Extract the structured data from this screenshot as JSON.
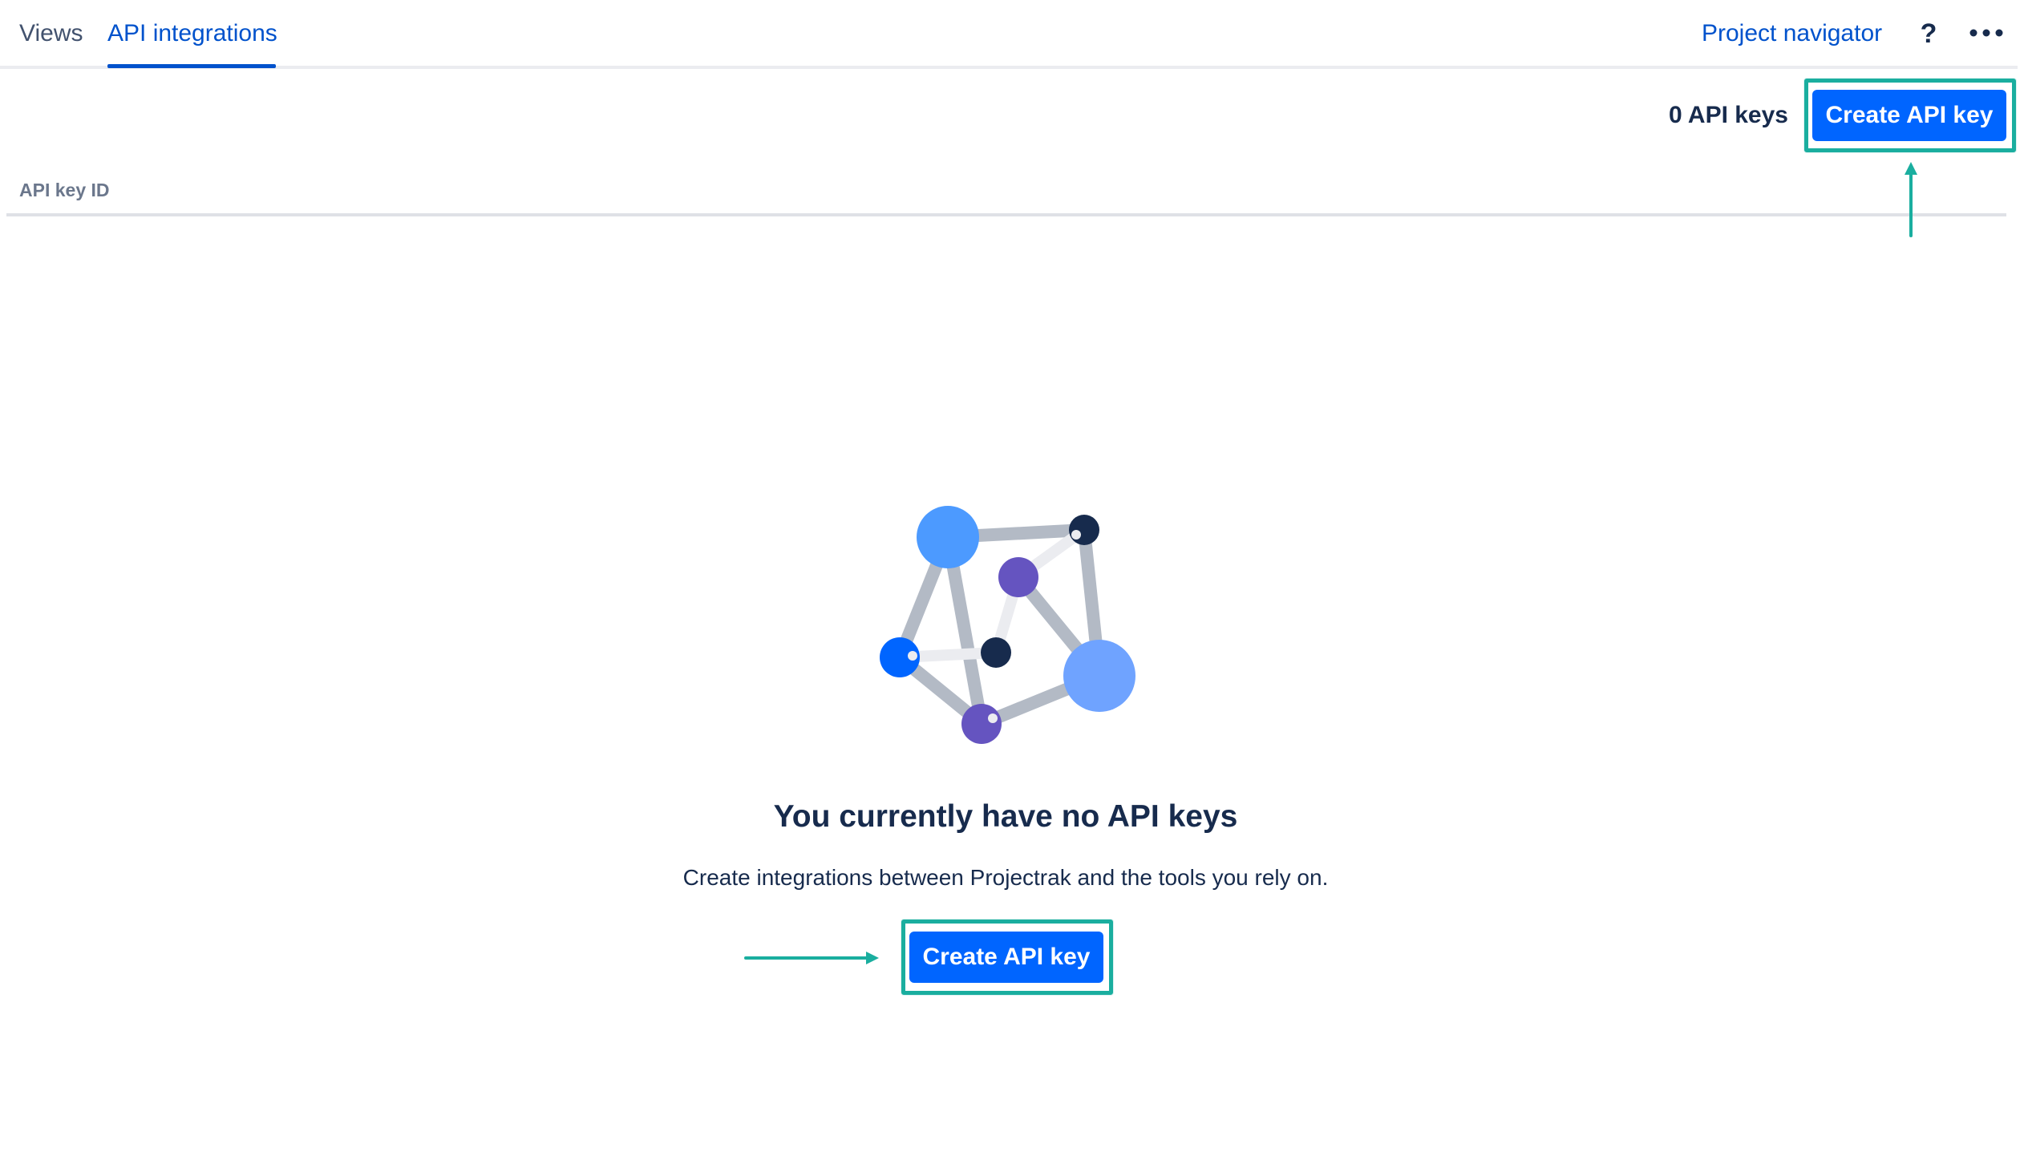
{
  "nav": {
    "tabs": [
      {
        "label": "Views",
        "active": false
      },
      {
        "label": "API integrations",
        "active": true
      }
    ],
    "project_navigator": "Project navigator",
    "help_label": "?",
    "more_icon": "more-horizontal-icon"
  },
  "header": {
    "api_key_count": "0 API keys",
    "create_button": "Create API key"
  },
  "table": {
    "columns": [
      "API key ID"
    ]
  },
  "empty_state": {
    "illustration": "network-graph-illustration",
    "title": "You currently have no API keys",
    "description": "Create integrations between Projectrak and the tools you rely on.",
    "create_button": "Create API key"
  },
  "colors": {
    "primary": "#0065ff",
    "link": "#0052cc",
    "text": "#172b4d",
    "annotation": "#1aae9f"
  }
}
